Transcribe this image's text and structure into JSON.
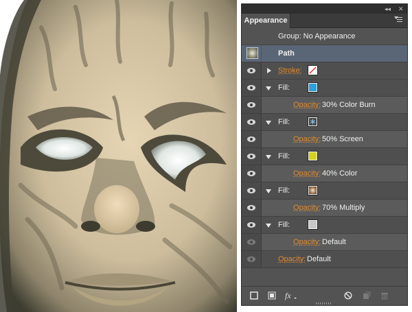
{
  "panel": {
    "tab_label": "Appearance",
    "collapse_glyph": "◂◂",
    "close_glyph": "✕",
    "rows": [
      {
        "kind": "group",
        "label": "Group: No Appearance"
      },
      {
        "kind": "path",
        "label": "Path",
        "thumbnail_icon": "path-thumbnail"
      },
      {
        "kind": "attribute",
        "label": "Stroke:",
        "expanded": false,
        "swatch": "none-swatch"
      },
      {
        "kind": "attribute",
        "label": "Fill:",
        "expanded": true,
        "swatch": "#2ca0dc"
      },
      {
        "kind": "opacity",
        "label": "Opacity:",
        "value": "30% Color Burn"
      },
      {
        "kind": "attribute",
        "label": "Fill:",
        "expanded": true,
        "swatch": "pattern-snowflake"
      },
      {
        "kind": "opacity",
        "label": "Opacity:",
        "value": "50% Screen"
      },
      {
        "kind": "attribute",
        "label": "Fill:",
        "expanded": true,
        "swatch": "#d4d21a"
      },
      {
        "kind": "opacity",
        "label": "Opacity:",
        "value": "40% Color"
      },
      {
        "kind": "attribute",
        "label": "Fill:",
        "expanded": true,
        "swatch": "gradient-radial-brown"
      },
      {
        "kind": "opacity",
        "label": "Opacity:",
        "value": "70% Multiply"
      },
      {
        "kind": "attribute",
        "label": "Fill:",
        "expanded": true,
        "swatch": "#c8c8c8"
      },
      {
        "kind": "opacity",
        "label": "Opacity:",
        "value": "Default"
      },
      {
        "kind": "opacity-path",
        "label": "Opacity:",
        "value": "Default"
      }
    ],
    "bottom_icons": [
      "add-new-stroke-icon",
      "add-new-fill-icon",
      "add-new-effect-icon",
      "clear-appearance-icon",
      "duplicate-item-icon",
      "delete-item-icon"
    ],
    "effect_label": "fx"
  },
  "colors": {
    "panel_bg": "#535353",
    "selected_row": "#5a6676",
    "orange_link": "#e08b2f",
    "skin_light": "#e2d2b2",
    "skin_shadow": "#4a4838"
  },
  "artwork": {
    "subject": "stylized face illustration"
  }
}
